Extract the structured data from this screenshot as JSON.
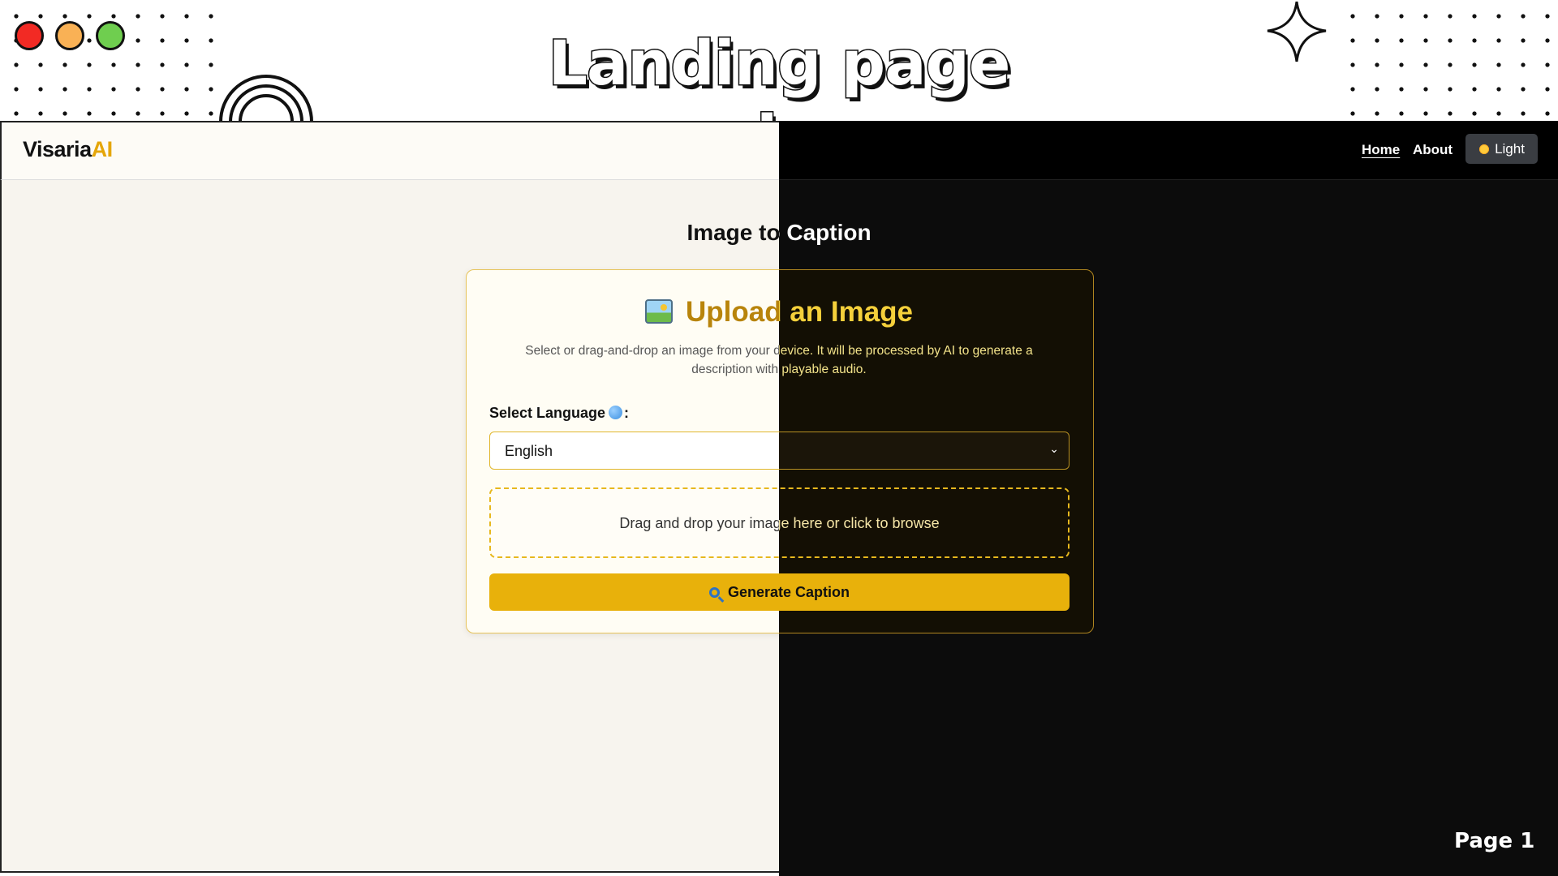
{
  "slide": {
    "title": "Landing page :-",
    "page_number": "Page 1"
  },
  "app": {
    "brand_main": "Visaria",
    "brand_accent": "AI",
    "nav": {
      "home": "Home",
      "about": "About",
      "theme_toggle": "Light"
    },
    "page_heading": "Image to Caption",
    "card": {
      "title": "Upload an Image",
      "description": "Select or drag-and-drop an image from your device. It will be processed by AI to generate a description with playable audio.",
      "language_label": "Select Language",
      "language_label_suffix": ":",
      "language_selected": "English",
      "drop_zone_text": "Drag and drop your image here or click to browse",
      "generate_button": "Generate Caption"
    }
  },
  "colors": {
    "accent": "#e8b10b",
    "light_bg": "#f7f4ee",
    "dark_bg": "#0c0c0c"
  },
  "icons": [
    "image-icon",
    "globe-icon",
    "search-icon",
    "sun-icon",
    "chevron-down-icon",
    "sparkle-icon",
    "rainbow-icon"
  ]
}
